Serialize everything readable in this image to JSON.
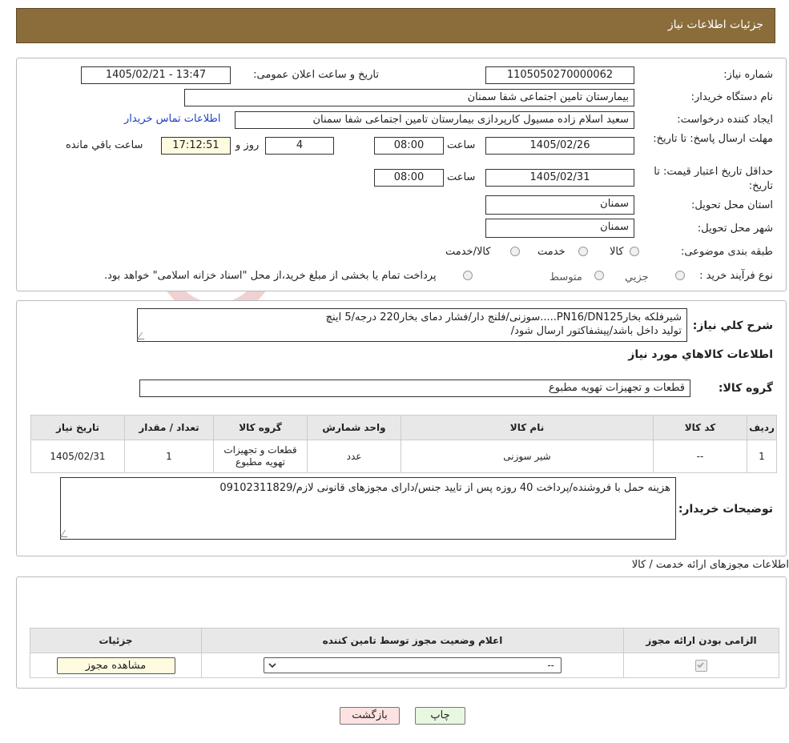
{
  "header": {
    "title": "جزئیات اطلاعات نیاز"
  },
  "form": {
    "need_number_label": "شماره نیاز:",
    "need_number": "1105050270000062",
    "announce_label": "تاریخ و ساعت اعلان عمومی:",
    "announce_value": "1405/02/21 - 13:47",
    "buyer_org_label": "نام دستگاه خریدار:",
    "buyer_org": "بیمارستان تامین اجتماعی شفا سمنان",
    "creator_label": "ایجاد کننده درخواست:",
    "creator": "سعید اسلام زاده مسیول کارپردازی بیمارستان تامین اجتماعی شفا سمنان",
    "contact_link": "اطلاعات تماس خریدار",
    "deadline_label": "مهلت ارسال پاسخ: تا تاریخ:",
    "deadline_date": "1405/02/26",
    "time_label": "ساعت",
    "deadline_time": "08:00",
    "days_value": "4",
    "days_label": "روز و",
    "remaining_time": "17:12:51",
    "remaining_label": "ساعت باقي مانده",
    "price_validity_label": "حداقل تاریخ اعتبار قیمت: تا تاریخ:",
    "price_validity_date": "1405/02/31",
    "price_validity_time": "08:00",
    "province_label": "استان محل تحویل:",
    "province": "سمنان",
    "city_label": "شهر محل تحویل:",
    "city": "سمنان",
    "category_label": "طبقه بندی موضوعی:",
    "category_options": [
      "کالا",
      "خدمت",
      "کالا/خدمت"
    ],
    "purchase_type_label": "نوع فرآیند خرید :",
    "purchase_options": [
      "جزیي",
      "متوسط"
    ],
    "purchase_note": "پرداخت تمام یا بخشی از مبلغ خرید،از محل \"اسناد خزانه اسلامی\" خواهد بود."
  },
  "description": {
    "label": "شرح کلي نیاز:",
    "line1": "شیرفلکه بخارPN16/DN125.....سوزنی/فلنج دار/فشار دمای بخار220 درجه/5 اینچ",
    "line2": "تولید داخل باشد/پیشفاکتور ارسال شود/"
  },
  "goods": {
    "section_title": "اطلاعات کالاهاي مورد نیاز",
    "group_label": "گروه کالا:",
    "group_value": "قطعات و تجهیزات تهویه مطبوع",
    "columns": [
      "ردیف",
      "کد کالا",
      "نام کالا",
      "واحد شمارش",
      "گروه کالا",
      "تعداد / مقدار",
      "تاریخ نیاز"
    ],
    "rows": [
      [
        "1",
        "--",
        "شیر سوزنی",
        "عدد",
        "قطعات و تجهیزات تهویه مطبوع",
        "1",
        "1405/02/31"
      ]
    ]
  },
  "buyer_notes": {
    "label": "توضیحات خریدار:",
    "text": "هزینه حمل با فروشنده/پرداخت 40 روزه پس از تایید جنس/دارای مجوزهای قانونی لازم/09102311829"
  },
  "permits": {
    "section_title": "اطلاعات مجوزهای ارائه خدمت / کالا",
    "columns": [
      "الزامی بودن ارائه مجوز",
      "اعلام وضعیت مجوز توسط تامین کننده",
      "جزئیات"
    ],
    "select_value": "--",
    "view_button": "مشاهده مجوز"
  },
  "buttons": {
    "print": "چاپ",
    "back": "بازگشت"
  },
  "watermark": "AriaTender.neT",
  "colors": {
    "header_bg": "#8a6d3b",
    "back_btn_bg": "#fde2e2",
    "print_btn_bg": "#e8f7e0"
  }
}
